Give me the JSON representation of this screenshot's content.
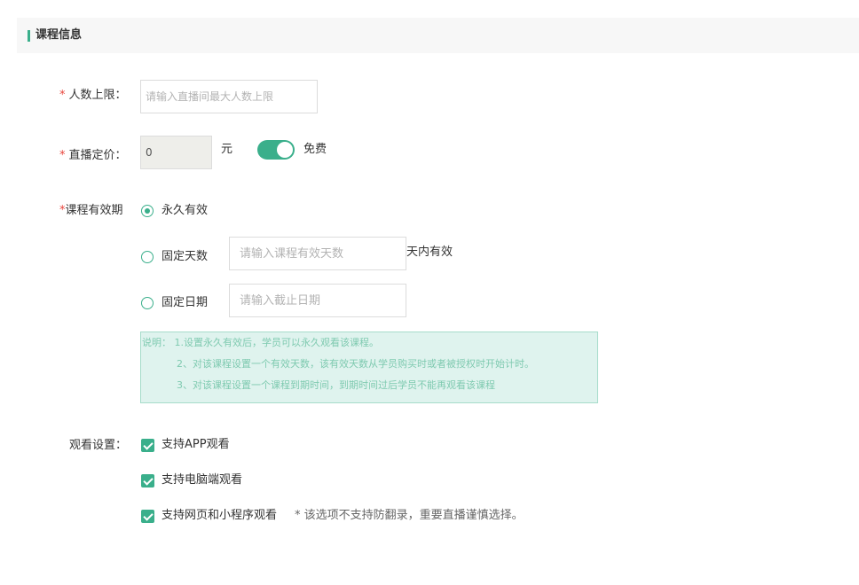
{
  "section": {
    "title": "课程信息"
  },
  "max_people": {
    "required": "*",
    "label": "人数上限：",
    "placeholder": "请输入直播间最大人数上限"
  },
  "price": {
    "required": "*",
    "label": "直播定价：",
    "value": "0",
    "unit": "元",
    "free_label": "免费",
    "free_on": true
  },
  "validity": {
    "required": "*",
    "label": "课程有效期",
    "options": [
      {
        "label": "永久有效",
        "checked": true
      },
      {
        "label": "固定天数",
        "checked": false,
        "placeholder": "请输入课程有效天数",
        "suffix": "天内有效"
      },
      {
        "label": "固定日期",
        "checked": false,
        "placeholder": "请输入截止日期"
      }
    ],
    "note": [
      "说明：  1.设置永久有效后，学员可以永久观看该课程。",
      "2、对该课程设置一个有效天数，该有效天数从学员购买时或者被授权时开始计时。",
      "3、对该课程设置一个课程到期时间，到期时间过后学员不能再观看该课程"
    ]
  },
  "viewing": {
    "label": "观看设置：",
    "options": [
      {
        "label": "支持APP观看",
        "checked": true
      },
      {
        "label": "支持电脑端观看",
        "checked": true
      },
      {
        "label": "支持网页和小程序观看",
        "checked": true,
        "hint": "* 该选项不支持防翻录，重要直播谨慎选择。"
      }
    ]
  },
  "colors": {
    "accent": "#3aaf8b",
    "required": "#e8453c",
    "note_bg": "#dff3ee"
  }
}
